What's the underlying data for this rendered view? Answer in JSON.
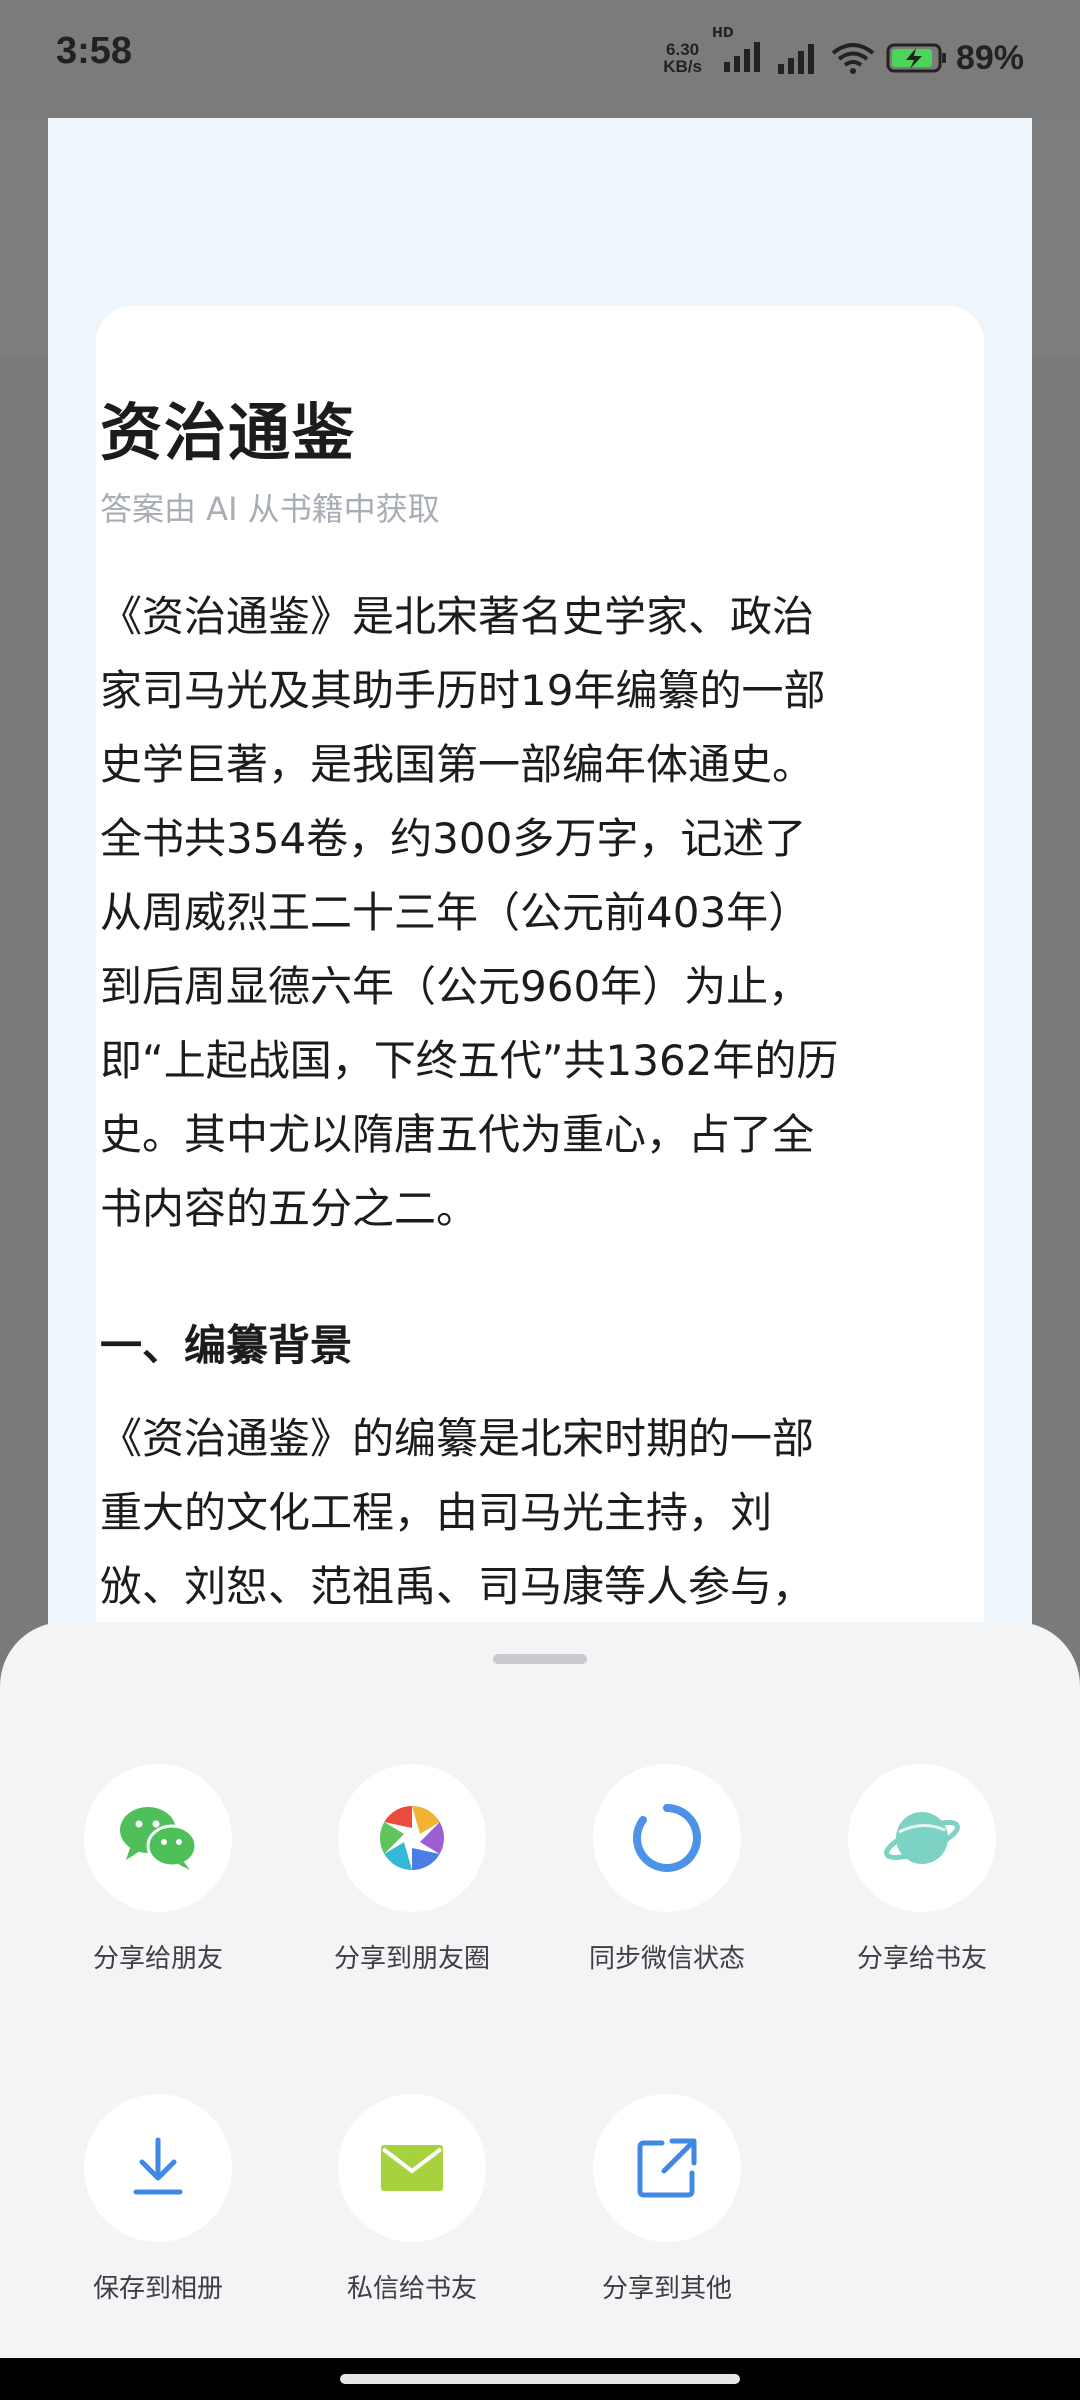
{
  "status_bar": {
    "time": "3:58",
    "net_speed_value": "6.30",
    "net_speed_unit": "KB/s",
    "network_badge": "HD",
    "battery_percent": "89%",
    "icons": [
      "signal-bars-icon",
      "signal-bars-icon",
      "wifi-icon",
      "battery-charging-icon"
    ]
  },
  "article": {
    "title": "资治通鉴",
    "source": "答案由 AI 从书籍中获取",
    "intro_lines": [
      "《资治通鉴》是北宋著名史学家、政治",
      "家司马光及其助手历时19年编纂的一部",
      "史学巨著，是我国第一部编年体通史。",
      "全书共354卷，约300多万字，记述了",
      "从周威烈王二十三年（公元前403年）",
      "到后周显德六年（公元960年）为止，",
      "即“上起战国，下终五代”共1362年的历",
      "史。其中尤以隋唐五代为重心，占了全",
      "书内容的五分之二。"
    ],
    "section_heading": "一、编纂背景",
    "section_lines": [
      "《资治通鉴》的编纂是北宋时期的一部",
      "重大的文化工程，由司马光主持，刘",
      "攽、刘恕、范祖禹、司马康等人参与，"
    ]
  },
  "share_sheet": {
    "row1": [
      {
        "label": "分享给朋友",
        "icon": "wechat-icon"
      },
      {
        "label": "分享到朋友圈",
        "icon": "moments-aperture-icon"
      },
      {
        "label": "同步微信状态",
        "icon": "status-ring-icon"
      },
      {
        "label": "分享给书友",
        "icon": "planet-icon"
      }
    ],
    "row2": [
      {
        "label": "保存到相册",
        "icon": "download-icon"
      },
      {
        "label": "私信给书友",
        "icon": "mail-icon"
      },
      {
        "label": "分享到其他",
        "icon": "external-share-icon"
      }
    ],
    "colors": {
      "wechat": "#4fbf5a",
      "ring": "#4c93e8",
      "planet": "#7dd3c3",
      "download": "#3f88e6",
      "mail": "#a6d33d",
      "external": "#3f88e6"
    }
  }
}
